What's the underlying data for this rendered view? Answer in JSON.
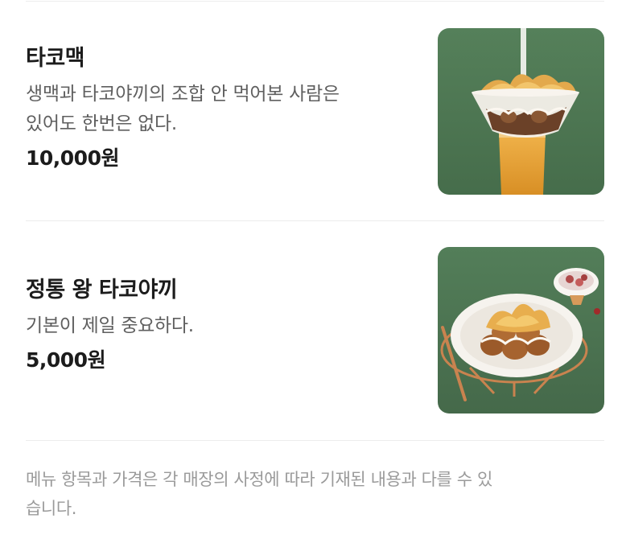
{
  "menu": {
    "items": [
      {
        "name": "타코맥",
        "description_lines": [
          "생맥과 타코야끼의 조합 안 먹어본 사람은",
          "있어도 한번은 없다."
        ],
        "price": "10,000원",
        "image_icon": "takoyaki-beer-cup-photo"
      },
      {
        "name": "정통 왕 타코야끼",
        "description_lines": [
          "기본이 제일 중요하다."
        ],
        "price": "5,000원",
        "image_icon": "takoyaki-plate-photo"
      }
    ]
  },
  "footer": {
    "notice_lines": [
      "메뉴 항목과 가격은 각 매장의 사정에 따라 기재된 내용과 다를 수 있",
      "습니다."
    ]
  },
  "colors": {
    "photo_background": "#4f7a55",
    "beer": "#e7a238",
    "divider": "#ececec",
    "notice_text": "#9a9a9a"
  }
}
